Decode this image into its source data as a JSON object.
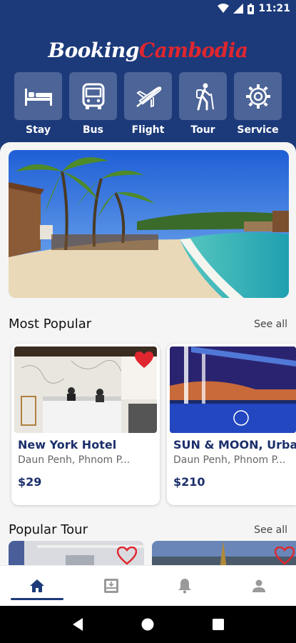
{
  "status_bar": {
    "time": "11:21"
  },
  "brand": {
    "part1": "Booking",
    "part2": "Cambodia"
  },
  "categories": [
    {
      "label": "Stay",
      "icon": "bed-icon"
    },
    {
      "label": "Bus",
      "icon": "bus-icon"
    },
    {
      "label": "Flight",
      "icon": "airplane-icon"
    },
    {
      "label": "Tour",
      "icon": "hiker-icon"
    },
    {
      "label": "Service",
      "icon": "gear-icon"
    }
  ],
  "most_popular": {
    "title": "Most Popular",
    "see_all": "See all",
    "items": [
      {
        "name": "New York Hotel",
        "address": "Daun Penh, Phnom P...",
        "price": "$29",
        "favorited": true
      },
      {
        "name": "SUN & MOON, Urba",
        "address": "Daun Penh, Phnom P...",
        "price": "$210",
        "favorited": false
      }
    ]
  },
  "popular_tour": {
    "title": "Popular Tour",
    "see_all": "See all"
  },
  "bottom_nav": [
    {
      "name": "home",
      "icon": "home-icon",
      "active": true
    },
    {
      "name": "bookings",
      "icon": "inbox-download-icon",
      "active": false
    },
    {
      "name": "notifications",
      "icon": "bell-icon",
      "active": false
    },
    {
      "name": "profile",
      "icon": "person-icon",
      "active": false
    }
  ],
  "colors": {
    "primary": "#1c3a7a",
    "accent": "#e0262e",
    "tile": "#4c6497"
  }
}
